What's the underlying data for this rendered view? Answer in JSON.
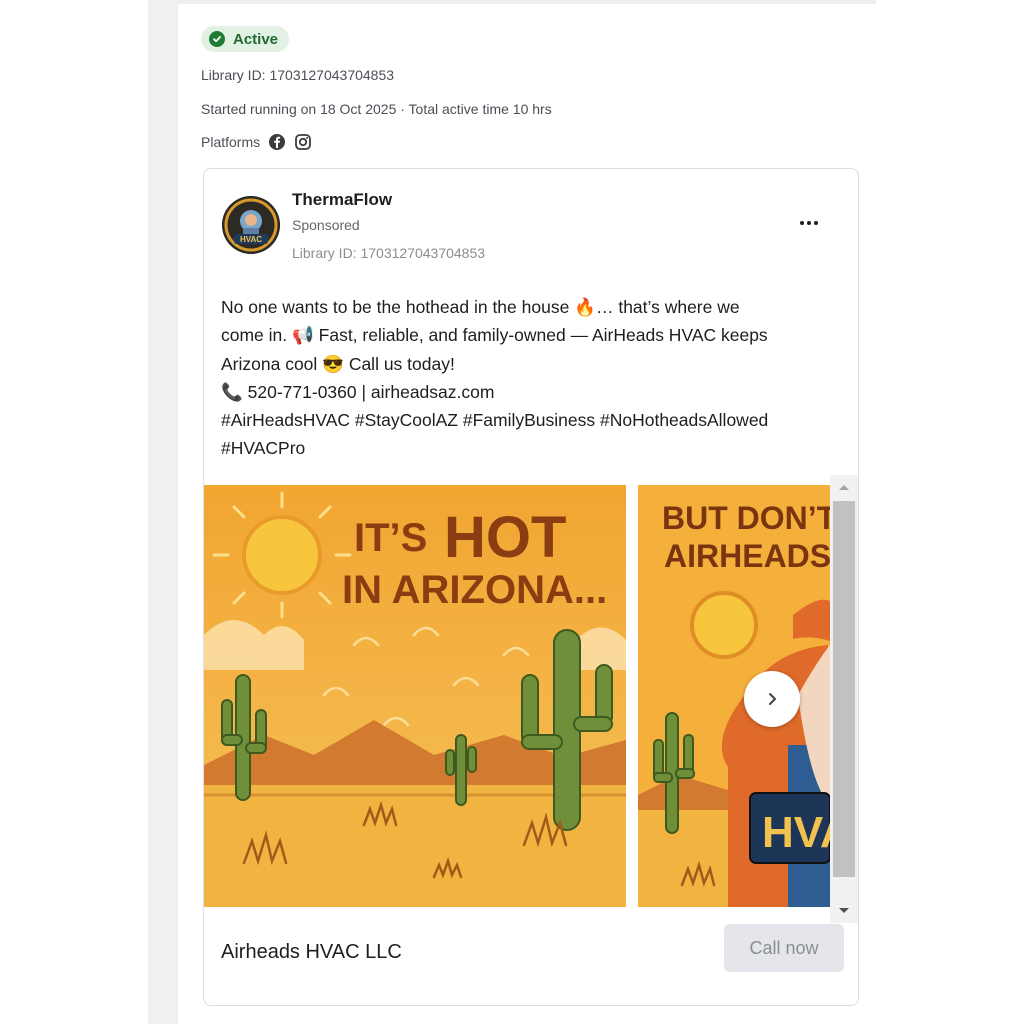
{
  "status": {
    "label": "Active",
    "color": "#1f7d33"
  },
  "library_id_line": "Library ID: 1703127043704853",
  "run_info": "Started running on 18 Oct 2025 · Total active time 10 hrs",
  "platforms": {
    "label": "Platforms",
    "icons": [
      "facebook-icon",
      "instagram-icon"
    ]
  },
  "ad": {
    "advertiser": "ThermaFlow",
    "sponsored": "Sponsored",
    "library_id": "Library ID: 1703127043704853",
    "body_lines": [
      "No one wants to be the hothead in the house 🔥… that’s where we",
      "come in. 📢 Fast, reliable, and family-owned — AirHeads HVAC keeps",
      "Arizona cool 😎 Call us today!",
      "📞 520-771-0360 | airheadsaz.com",
      "#AirHeadsHVAC #StayCoolAZ #FamilyBusiness #NoHotheadsAllowed",
      "#HVACPro"
    ],
    "slides": [
      {
        "headline_line1_small": "IT’S",
        "headline_line1_big": "HOT",
        "headline_line2": "IN ARIZONA..."
      },
      {
        "headline_line1": "BUT DON’T",
        "headline_line2": "AIRHEADS",
        "sign_text": "HVAC"
      }
    ],
    "avatar_text": "HVAC",
    "footer_name": "Airheads HVAC LLC",
    "cta_label": "Call now"
  }
}
